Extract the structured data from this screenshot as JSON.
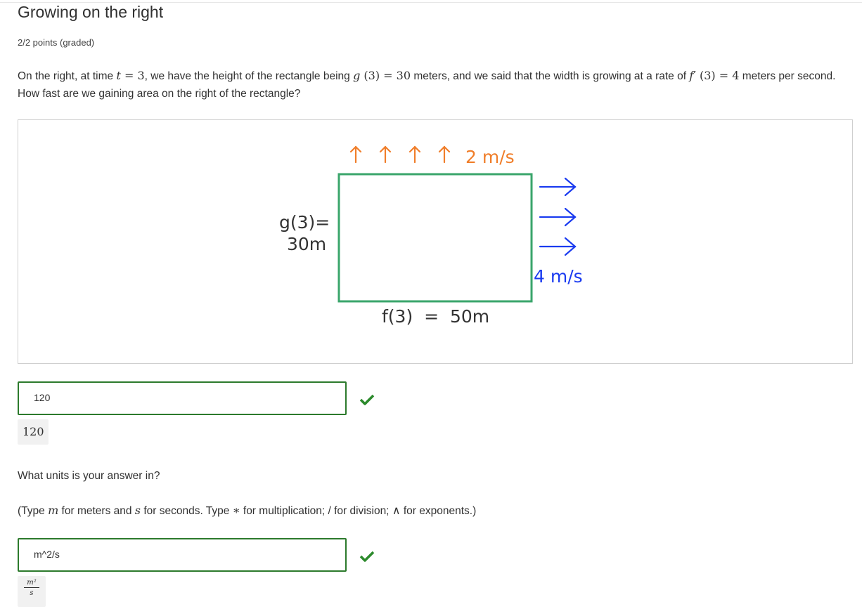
{
  "problem": {
    "title": "Growing on the right",
    "points": "2/2 points (graded)",
    "prompt": {
      "p1": "On the right, at time ",
      "t": "t",
      "eq1": " = 3",
      "p2": ", we have the height of the rectangle being ",
      "g": "g",
      "g_arg": " (3)",
      "eq2": " = 30",
      "p3": " meters, and we said that the width is growing at a rate of ",
      "fprime": "f′",
      "f_arg": " (3)",
      "eq3": " = 4",
      "p4": " meters per second. How fast are we gaining area on the right of the rectangle?"
    }
  },
  "figure": {
    "top_rate_label": "2 m/s",
    "right_rate_label": "4 m/s",
    "height_label_line1": "g(3)=",
    "height_label_line2": "30m",
    "width_label": "f(3)  =  50m",
    "colors": {
      "rectangle": "#3aa56b",
      "top_arrows": "#f07e2a",
      "right_arrows": "#1a3bf0"
    }
  },
  "answer1": {
    "value": "120",
    "preview": "120",
    "status": "correct"
  },
  "question2": {
    "text": "What units is your answer in?",
    "hint": {
      "h1": "(Type ",
      "m": "m",
      "h2": " for meters and ",
      "s": "s",
      "h3": " for seconds. Type ",
      "star": "∗",
      "h4": " for multiplication; / for division; ",
      "caret": "∧",
      "h5": " for exponents.)"
    }
  },
  "answer2": {
    "value": "m^2/s",
    "preview_num": "m²",
    "preview_den": "s",
    "status": "correct"
  },
  "icons": {
    "correct": "checkmark-icon",
    "arrow_up": "arrow-up-icon",
    "arrow_right": "arrow-right-icon"
  }
}
